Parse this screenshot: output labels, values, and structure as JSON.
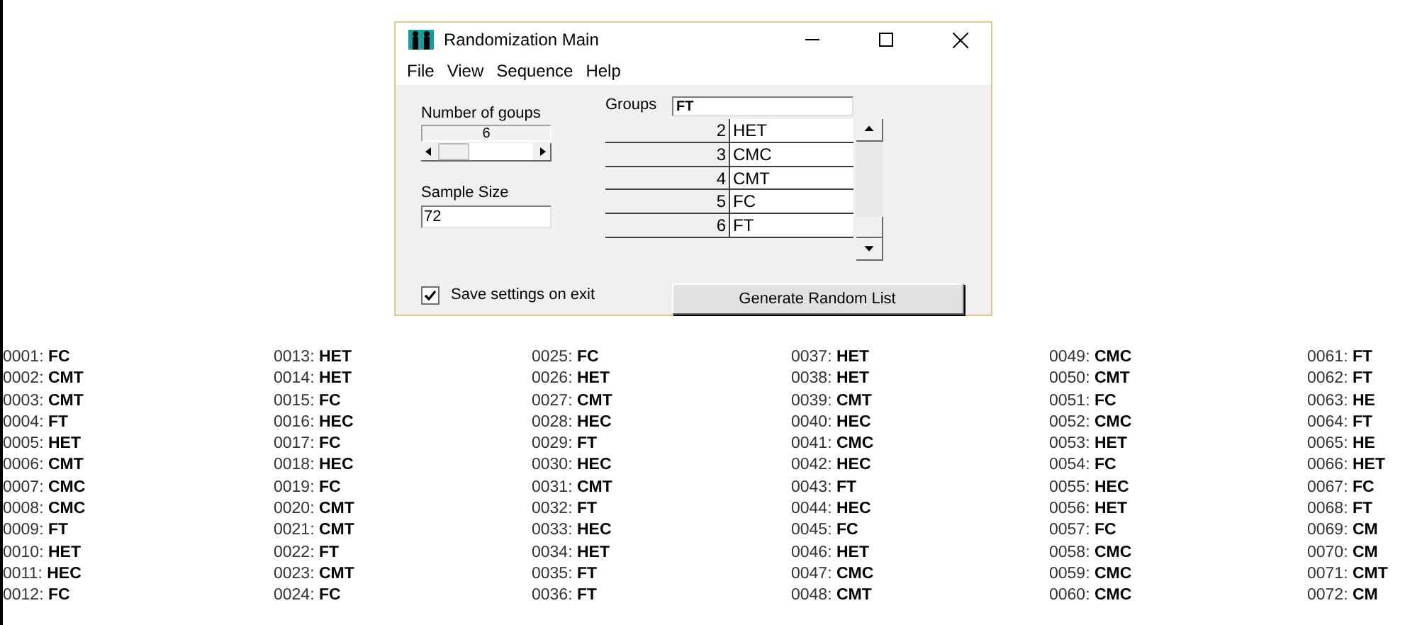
{
  "window": {
    "title": "Randomization Main"
  },
  "menu": [
    "File",
    "View",
    "Sequence",
    "Help"
  ],
  "number_of_groups": {
    "label": "Number of goups",
    "value": "6"
  },
  "sample_size": {
    "label": "Sample Size",
    "value": "72"
  },
  "groups": {
    "label": "Groups",
    "value": "FT",
    "rows": [
      {
        "number": "2",
        "name": "HET"
      },
      {
        "number": "3",
        "name": "CMC"
      },
      {
        "number": "4",
        "name": "CMT"
      },
      {
        "number": "5",
        "name": "FC"
      },
      {
        "number": "6",
        "name": "FT"
      }
    ]
  },
  "save_settings": {
    "label": "Save settings on exit",
    "checked": true
  },
  "generate_button": "Generate Random List",
  "list": [
    "0001: **FC**",
    "0002: **CMT**",
    "0003: **CMT**",
    "0004: **FT**",
    "0005: **HET**",
    "0006: **CMT**",
    "0007: **CMC**",
    "0008: **CMC**",
    "0009: **FT**",
    "0010: **HET**",
    "0011: **HEC**",
    "0012: **FC**",
    "0013: **HET**",
    "0014: **HET**",
    "0015: **FC**",
    "0016: **HEC**",
    "0017: **FC**",
    "0018: **HEC**",
    "0019: **FC**",
    "0020: **CMT**",
    "0021: **CMT**",
    "0022: **FT**",
    "0023: **CMT**",
    "0024: **FC**",
    "0025: **FC**",
    "0026: **HET**",
    "0027: **CMT**",
    "0028: **HEC**",
    "0029: **FT**",
    "0030: **HEC**",
    "0031: **CMT**",
    "0032: **FT**",
    "0033: **HEC**",
    "0034: **HET**",
    "0035: **FT**",
    "0036: **FT**",
    "0037: **HET**",
    "0038: **HET**",
    "0039: **CMT**",
    "0040: **HEC**",
    "0041: **CMC**",
    "0042: **HEC**",
    "0043: **FT**",
    "0044: **HEC**",
    "0045: **FC**",
    "0046: **HET**",
    "0047: **CMC**",
    "0048: **CMT**",
    "0049: **CMC**",
    "0050: **CMT**",
    "0051: **FC**",
    "0052: **CMC**",
    "0053: **HET**",
    "0054: **FC**",
    "0055: **HEC**",
    "0056: **HET**",
    "0057: **FC**",
    "0058: **CMC**",
    "0059: **CMC**",
    "0060: **CMC**",
    "0061: **FT**",
    "0062: **FT**",
    "0063: **HE**",
    "0064: **FT**",
    "0065: **HE**",
    "0066: **HET**",
    "0067: **FC**",
    "0068: **FT**",
    "0069: **CM**",
    "0070: **CM**",
    "0071: **CMT**",
    "0072: **CM**"
  ]
}
